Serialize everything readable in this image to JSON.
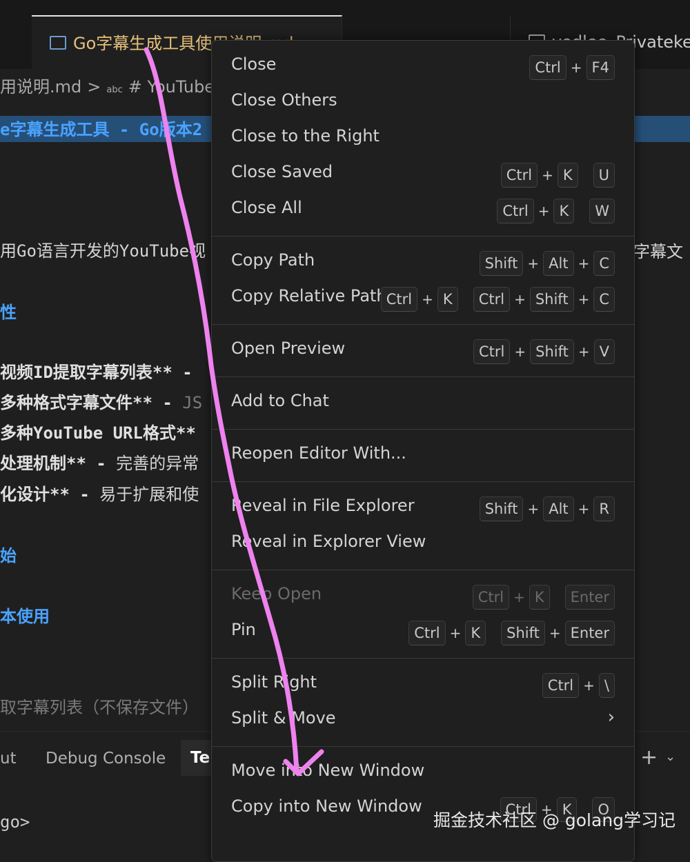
{
  "tabs": {
    "active": "Go字幕生成工具使用说明.md",
    "tab2": "",
    "tab3": "yodlee_Privatekey.t"
  },
  "breadcrumb": {
    "file": "用说明.md",
    "sep": ">",
    "abc": "abc",
    "section": "# YouTube"
  },
  "editor": {
    "line1": "e字幕生成工具 - Go版本2",
    "line2": "用Go语言开发的YouTube视",
    "line2_right": "字幕文",
    "line3": "性",
    "line4": "视频ID提取字幕列表** -",
    "line5a": "多种格式字幕文件** - ",
    "line5b": "JS",
    "line6": "多种YouTube URL格式**",
    "line7a": "处理机制** - ",
    "line7b": "完善的异常",
    "line8a": "化设计** - ",
    "line8b": "易于扩展和使",
    "line9": "始",
    "line10": "本使用",
    "line11": "取字幕列表（不保存文件）"
  },
  "panel": {
    "tab_output": "ut",
    "tab_debug": "Debug Console",
    "tab_terminal": "Ter",
    "prompt": "go>",
    "add": "+",
    "more": "⌄"
  },
  "menu": {
    "groups": [
      [
        {
          "label": "Close",
          "keys": [
            [
              "Ctrl",
              "F4"
            ]
          ]
        },
        {
          "label": "Close Others",
          "keys": []
        },
        {
          "label": "Close to the Right",
          "keys": []
        },
        {
          "label": "Close Saved",
          "keys": [
            [
              "Ctrl",
              "K"
            ],
            [
              "U"
            ]
          ]
        },
        {
          "label": "Close All",
          "keys": [
            [
              "Ctrl",
              "K"
            ],
            [
              "W"
            ]
          ]
        }
      ],
      [
        {
          "label": "Copy Path",
          "keys": [
            [
              "Shift",
              "Alt",
              "C"
            ]
          ]
        },
        {
          "label": "Copy Relative Path",
          "keys": [
            [
              "Ctrl",
              "K"
            ],
            [
              "Ctrl",
              "Shift",
              "C"
            ]
          ]
        }
      ],
      [
        {
          "label": "Open Preview",
          "keys": [
            [
              "Ctrl",
              "Shift",
              "V"
            ]
          ]
        }
      ],
      [
        {
          "label": "Add to Chat",
          "keys": []
        }
      ],
      [
        {
          "label": "Reopen Editor With...",
          "keys": []
        }
      ],
      [
        {
          "label": "Reveal in File Explorer",
          "keys": [
            [
              "Shift",
              "Alt",
              "R"
            ]
          ]
        },
        {
          "label": "Reveal in Explorer View",
          "keys": []
        }
      ],
      [
        {
          "label": "Keep Open",
          "keys": [
            [
              "Ctrl",
              "K"
            ],
            [
              "Enter"
            ]
          ],
          "disabled": true
        },
        {
          "label": "Pin",
          "keys": [
            [
              "Ctrl",
              "K"
            ],
            [
              "Shift",
              "Enter"
            ]
          ]
        }
      ],
      [
        {
          "label": "Split Right",
          "keys": [
            [
              "Ctrl",
              "\\"
            ]
          ]
        },
        {
          "label": "Split & Move",
          "keys": [],
          "submenu": true
        }
      ],
      [
        {
          "label": "Move into New Window",
          "keys": []
        },
        {
          "label": "Copy into New Window",
          "keys": [
            [
              "Ctrl",
              "K"
            ],
            [
              "O"
            ]
          ]
        }
      ]
    ]
  },
  "watermark": "掘金技术社区 @ golang学习记",
  "colors": {
    "annotation": "#ee82ee",
    "accent_blue": "#4aa3ff"
  }
}
